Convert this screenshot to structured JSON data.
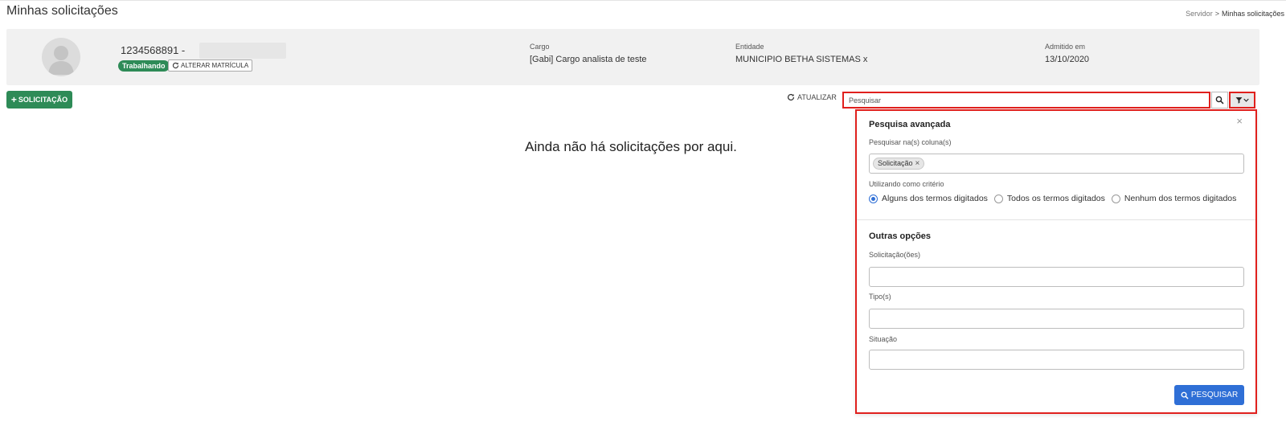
{
  "header": {
    "title": "Minhas solicitações",
    "breadcrumb": {
      "parent": "Servidor",
      "separator": ">",
      "current": "Minhas solicitações"
    }
  },
  "profile": {
    "matricula": "1234568891 -",
    "status": "Trabalhando",
    "change_registration_label": "ALTERAR MATRÍCULA",
    "cargo_label": "Cargo",
    "cargo_value": "[Gabi] Cargo analista de teste",
    "entidade_label": "Entidade",
    "entidade_value": "MUNICIPIO BETHA SISTEMAS x",
    "admitido_label": "Admitido em",
    "admitido_value": "13/10/2020"
  },
  "toolbar": {
    "add_request_label": "SOLICITAÇÃO",
    "refresh_label": "ATUALIZAR",
    "search_placeholder": "Pesquisar"
  },
  "empty_message": "Ainda não há solicitações por aqui.",
  "advanced_search": {
    "title": "Pesquisa avançada",
    "columns_label": "Pesquisar na(s) coluna(s)",
    "column_tags": [
      "Solicitação"
    ],
    "criteria_label": "Utilizando como critério",
    "criteria_options": [
      "Alguns dos termos digitados",
      "Todos os termos digitados",
      "Nenhum dos termos digitados"
    ],
    "selected_criteria": "Alguns dos termos digitados",
    "other_options_title": "Outras opções",
    "requests_label": "Solicitação(ões)",
    "types_label": "Tipo(s)",
    "status_label": "Situação",
    "search_button_label": "PESQUISAR"
  },
  "colors": {
    "primary_green": "#2e8b57",
    "primary_blue": "#2f6fd6",
    "highlight_red": "#e0201d",
    "card_background": "#f1f1f1"
  },
  "icons": [
    "user-avatar-icon",
    "refresh-icon",
    "plus-icon",
    "search-icon",
    "filter-icon",
    "chevron-down-icon",
    "close-icon"
  ]
}
